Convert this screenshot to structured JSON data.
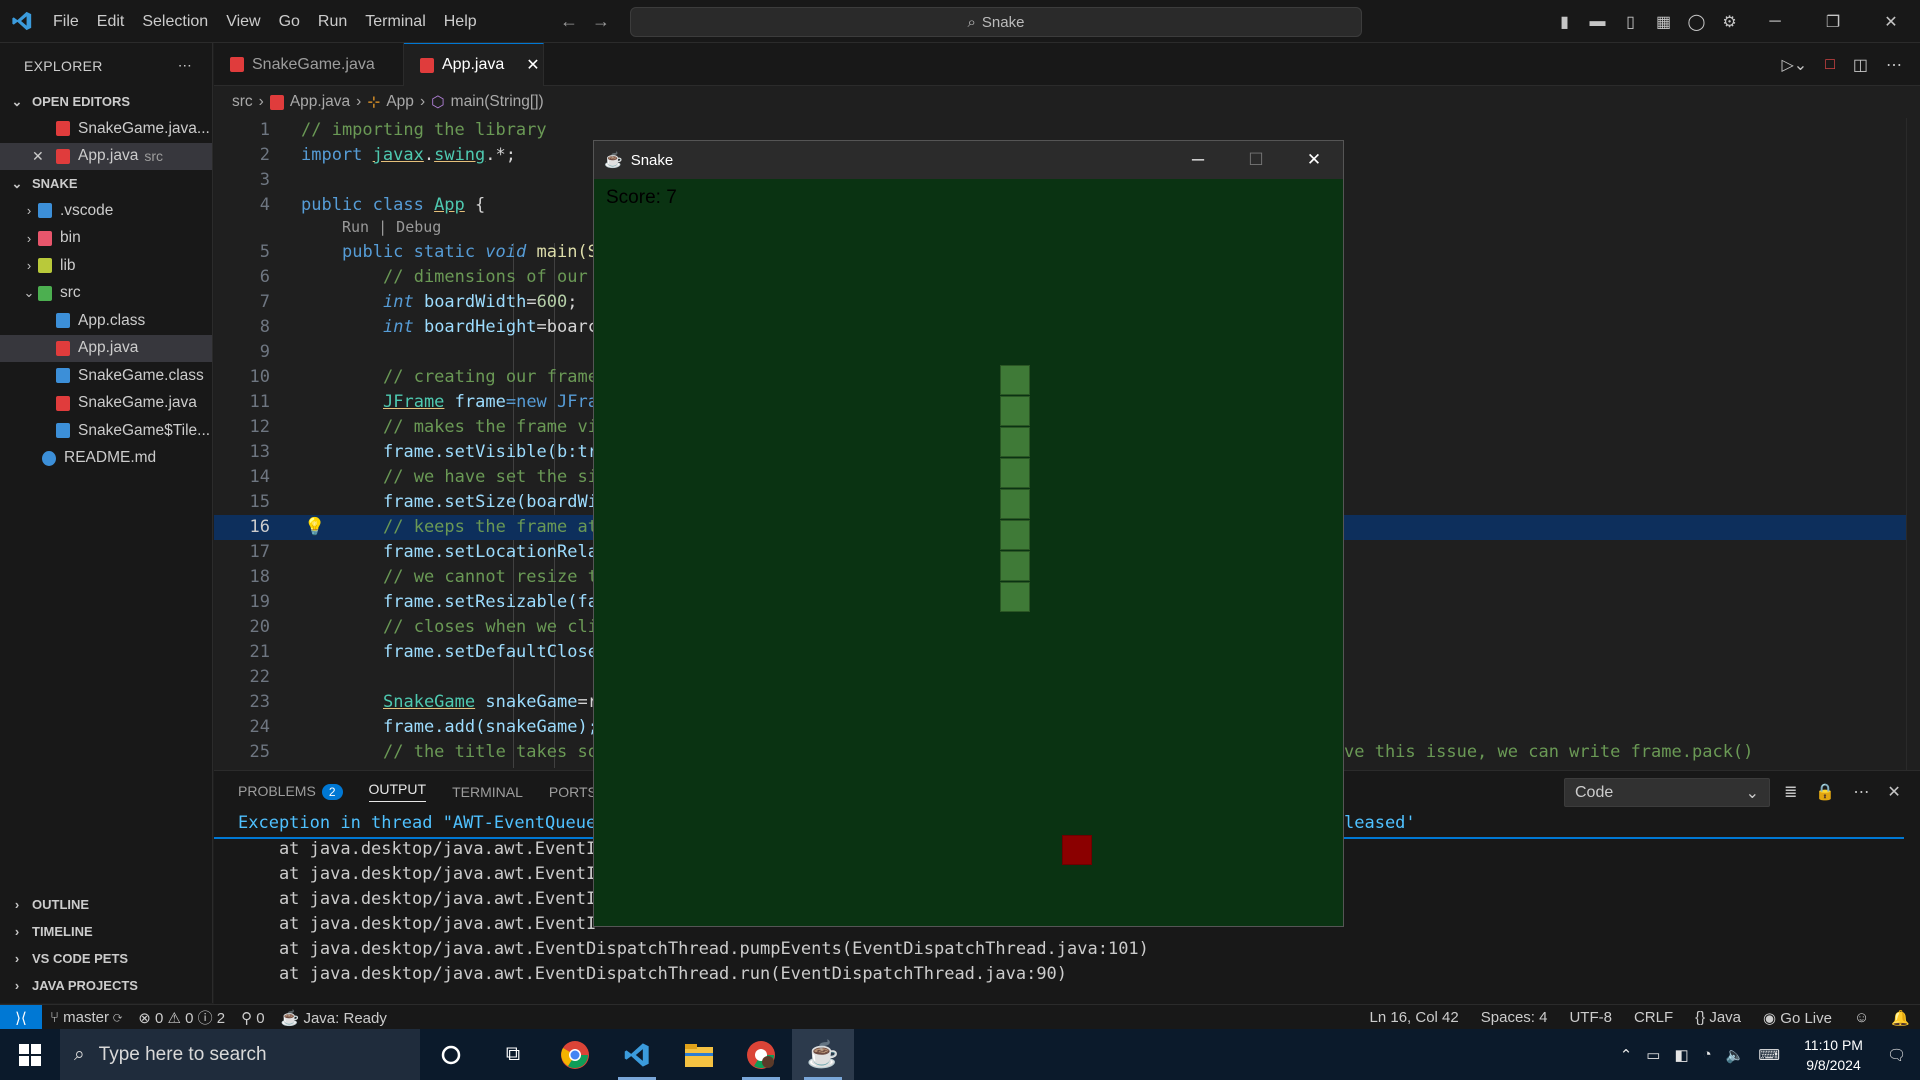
{
  "titlebar": {
    "menu": [
      "File",
      "Edit",
      "Selection",
      "View",
      "Go",
      "Run",
      "Terminal",
      "Help"
    ],
    "search": "Snake"
  },
  "explorer": {
    "title": "EXPLORER",
    "open_editors_label": "OPEN EDITORS",
    "open_editors": [
      {
        "name": "SnakeGame.java...",
        "desc": ""
      },
      {
        "name": "App.java",
        "desc": "src"
      }
    ],
    "workspace_label": "SNAKE",
    "tree": [
      {
        "name": ".vscode",
        "folder": true
      },
      {
        "name": "bin",
        "folder": true
      },
      {
        "name": "lib",
        "folder": true
      },
      {
        "name": "src",
        "folder": true
      },
      {
        "name": "App.class"
      },
      {
        "name": "App.java"
      },
      {
        "name": "SnakeGame.class"
      },
      {
        "name": "SnakeGame.java"
      },
      {
        "name": "SnakeGame$Tile..."
      },
      {
        "name": "README.md"
      }
    ],
    "bottom_sections": [
      "OUTLINE",
      "TIMELINE",
      "VS CODE PETS",
      "JAVA PROJECTS"
    ]
  },
  "tabs": [
    {
      "label": "SnakeGame.java",
      "active": false
    },
    {
      "label": "App.java",
      "active": true
    }
  ],
  "breadcrumb": [
    "src",
    "App.java",
    "App",
    "main(String[])"
  ],
  "editor": {
    "codelens": "Run | Debug",
    "line_numbers": [
      "1",
      "2",
      "3",
      "4",
      "5",
      "6",
      "7",
      "8",
      "9",
      "10",
      "11",
      "12",
      "13",
      "14",
      "15",
      "16",
      "17",
      "18",
      "19",
      "20",
      "21",
      "22",
      "23",
      "24",
      "25"
    ],
    "current_line": "16",
    "line1": "// importing the library",
    "line2_a": "import ",
    "line2_b": "javax",
    "line2_c": ".",
    "line2_d": "swing",
    "line2_e": ".*;",
    "line4_a": "public class ",
    "line4_b": "App",
    "line4_c": " {",
    "line5_a": "public static ",
    "line5_b": "void",
    "line5_c": " main(S",
    "line6": "// dimensions of our",
    "line7_a": "int",
    "line7_b": " boardWidth",
    "line7_c": "=",
    "line7_d": "600",
    "line7_e": ";",
    "line8_a": "int",
    "line8_b": " boardHeight",
    "line8_c": "=boarc",
    "line10": "// creating our frame",
    "line11_a": "JFrame",
    "line11_b": " frame",
    "line11_c": "=new JFra",
    "line12": "// makes the frame vi",
    "line13": "frame.setVisible(b:tr",
    "line14": "// we have set the si",
    "line15": "frame.setSize(boardWi",
    "line16": "// keeps the frame at",
    "line17": "frame.setLocationRela",
    "line18": "// we cannot resize t",
    "line19": "frame.setResizable(fa",
    "line20": "// closes when we cli",
    "line21": "frame.setDefaultClose",
    "line23_a": "SnakeGame",
    "line23_b": " snakeGame",
    "line23_c": "=r",
    "line24": "frame.add(snakeGame);",
    "line25_a": "// the title takes so",
    "line25_b": "ve this issue, we can write frame.pack()"
  },
  "panel": {
    "tabs": [
      "PROBLEMS",
      "OUTPUT",
      "TERMINAL",
      "PORTS"
    ],
    "problems_count": "2",
    "active_tab": "OUTPUT",
    "output_channel": "Code",
    "lines": [
      {
        "a": "Exception in thread \"AWT-EventQueue",
        "b": "leased'"
      },
      {
        "a": "    at java.desktop/java.awt.EventI",
        "b": ""
      },
      {
        "a": "    at java.desktop/java.awt.EventI",
        "b": ""
      },
      {
        "a": "    at java.desktop/java.awt.EventI",
        "b": ""
      },
      {
        "a": "    at java.desktop/java.awt.EventI",
        "b": ""
      },
      {
        "a": "    at java.desktop/java.awt.EventDispatchThread.pumpEvents(EventDispatchThread.java:101)",
        "b": ""
      },
      {
        "a": "    at java.desktop/java.awt.EventDispatchThread.run(EventDispatchThread.java:90)",
        "b": ""
      }
    ]
  },
  "statusbar": {
    "branch": "master",
    "errors": "0",
    "warnings": "0",
    "infos": "2",
    "ports": "0",
    "java": "Java: Ready",
    "position": "Ln 16, Col 42",
    "spaces": "Spaces: 4",
    "encoding": "UTF-8",
    "eol": "CRLF",
    "language": "Java",
    "golive": "Go Live"
  },
  "snake_window": {
    "title": "Snake",
    "score": "Score: 7",
    "snake_segments": 8,
    "food_color": "#8b0000",
    "snake_color": "#3f7a37",
    "board_color": "#0a3312"
  },
  "taskbar": {
    "search_placeholder": "Type here to search",
    "time": "11:10 PM",
    "date": "9/8/2024"
  },
  "colors": {
    "accent": "#0078d4",
    "editor_bg": "#1f1f1f",
    "comment": "#6a9955"
  }
}
